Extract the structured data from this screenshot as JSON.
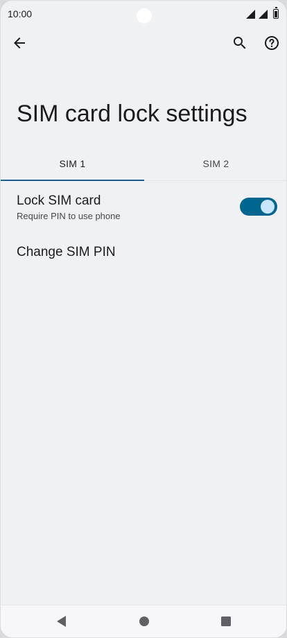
{
  "status_bar": {
    "time": "10:00",
    "icons": [
      "signal-icon",
      "signal-icon",
      "battery-icon"
    ]
  },
  "app_bar": {
    "back_icon": "arrow-left-icon",
    "search_icon": "search-icon",
    "help_icon": "help-circle-icon"
  },
  "page": {
    "title": "SIM card lock settings"
  },
  "tabs": [
    {
      "label": "SIM 1",
      "selected": true
    },
    {
      "label": "SIM 2",
      "selected": false
    }
  ],
  "settings": {
    "lock_sim": {
      "title": "Lock SIM card",
      "summary": "Require PIN to use phone",
      "enabled": true
    },
    "change_pin": {
      "title": "Change SIM PIN"
    }
  },
  "colors": {
    "accent": "#00658f",
    "tab_indicator": "#1f5f8b",
    "toggle_thumb": "#c6e7ff",
    "background": "#f0f1f4"
  },
  "nav_bar": {
    "icons": [
      "nav-back-icon",
      "nav-home-icon",
      "nav-recents-icon"
    ]
  }
}
